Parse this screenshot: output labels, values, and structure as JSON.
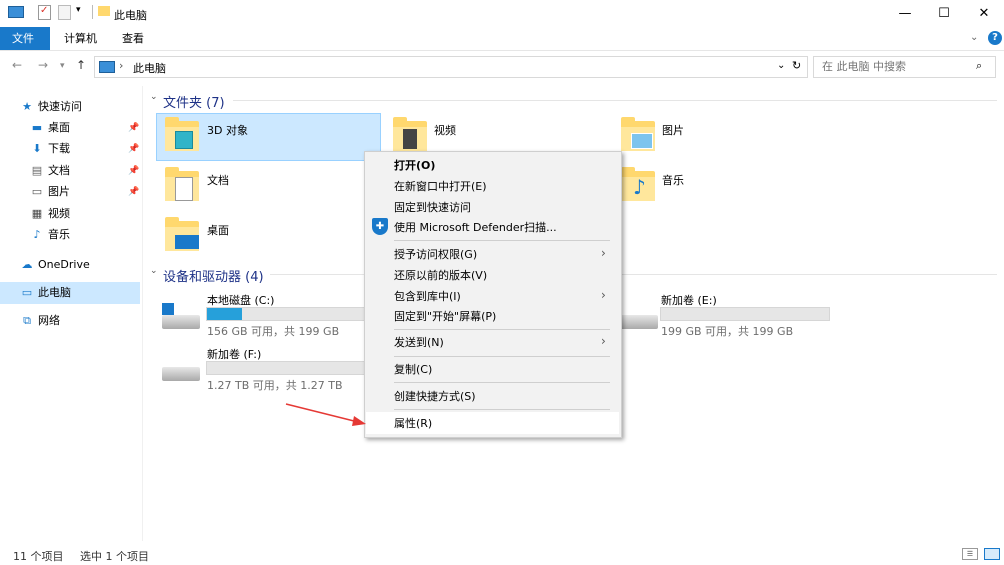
{
  "window": {
    "title": "此电脑",
    "minimize_glyph": "—",
    "maximize_glyph": "☐",
    "close_glyph": "✕"
  },
  "ribbon": {
    "tabs": [
      "文件",
      "计算机",
      "查看"
    ],
    "help_glyph": "?"
  },
  "address": {
    "path": "此电脑",
    "search_placeholder": "在 此电脑 中搜索"
  },
  "nav": {
    "quick_access": "快速访问",
    "items": [
      {
        "label": "桌面",
        "icon": "desktop-icon",
        "pinned": true
      },
      {
        "label": "下载",
        "icon": "download-icon",
        "pinned": true
      },
      {
        "label": "文档",
        "icon": "document-icon",
        "pinned": true
      },
      {
        "label": "图片",
        "icon": "picture-icon",
        "pinned": true
      },
      {
        "label": "视频",
        "icon": "video-icon",
        "pinned": false
      },
      {
        "label": "音乐",
        "icon": "music-icon",
        "pinned": false
      }
    ],
    "onedrive": "OneDrive",
    "this_pc": "此电脑",
    "network": "网络"
  },
  "content": {
    "folders_header": "文件夹 (7)",
    "folders": [
      "3D 对象",
      "视频",
      "图片",
      "文档",
      "音乐",
      "桌面"
    ],
    "devices_header": "设备和驱动器 (4)",
    "drives": [
      {
        "name": "本地磁盘 (C:)",
        "info": "156 GB 可用，共 199 GB",
        "used_fraction": 0.22
      },
      {
        "name": "新加卷 (E:)",
        "info": "199 GB 可用，共 199 GB",
        "used_fraction": 0.0
      },
      {
        "name": "新加卷 (F:)",
        "info": "1.27 TB 可用，共 1.27 TB",
        "used_fraction": 0.0
      }
    ]
  },
  "context_menu": {
    "items": [
      "打开(O)",
      "在新窗口中打开(E)",
      "固定到快速访问",
      "使用 Microsoft Defender扫描...",
      "授予访问权限(G)",
      "还原以前的版本(V)",
      "包含到库中(I)",
      "固定到\"开始\"屏幕(P)",
      "发送到(N)",
      "复制(C)",
      "创建快捷方式(S)",
      "属性(R)"
    ]
  },
  "status": {
    "count": "11 个项目",
    "selected": "选中 1 个项目"
  },
  "colors": {
    "accent": "#1979ca",
    "selection": "#cce8ff",
    "drive_fill": "#26a0da",
    "arrow": "#e53935"
  }
}
